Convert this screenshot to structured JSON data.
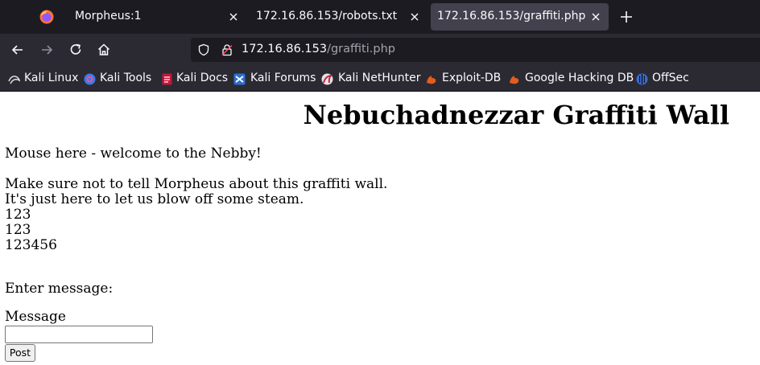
{
  "browser": {
    "tabs": [
      {
        "label": "Morpheus:1",
        "active": false
      },
      {
        "label": "172.16.86.153/robots.txt",
        "active": false
      },
      {
        "label": "172.16.86.153/graffiti.php",
        "active": true
      }
    ],
    "url": {
      "host": "172.16.86.153",
      "path": "/graffiti.php"
    },
    "bookmarks": [
      {
        "label": "Kali Linux",
        "icon": "kali-dragon-icon"
      },
      {
        "label": "Kali Tools",
        "icon": "kali-tools-icon"
      },
      {
        "label": "Kali Docs",
        "icon": "kali-docs-icon"
      },
      {
        "label": "Kali Forums",
        "icon": "kali-forums-icon"
      },
      {
        "label": "Kali NetHunter",
        "icon": "kali-nethunter-icon"
      },
      {
        "label": "Exploit-DB",
        "icon": "exploit-db-icon"
      },
      {
        "label": "Google Hacking DB",
        "icon": "ghdb-icon"
      },
      {
        "label": "OffSec",
        "icon": "offsec-icon"
      }
    ],
    "colors": {
      "tabbar": "#1c1b22",
      "toolbar": "#2b2a33",
      "active_tab": "#42414d",
      "accent": "#00ddff"
    }
  },
  "page": {
    "heading": "Nebuchadnezzar Graffiti Wall",
    "intro": "Mouse here - welcome to the Nebby!",
    "lines": [
      "Make sure not to tell Morpheus about this graffiti wall.",
      "It's just here to let us blow off some steam.",
      "123",
      "123",
      "123456"
    ],
    "form": {
      "prompt": "Enter message:",
      "field_label": "Message",
      "field_value": "",
      "submit_label": "Post"
    }
  }
}
